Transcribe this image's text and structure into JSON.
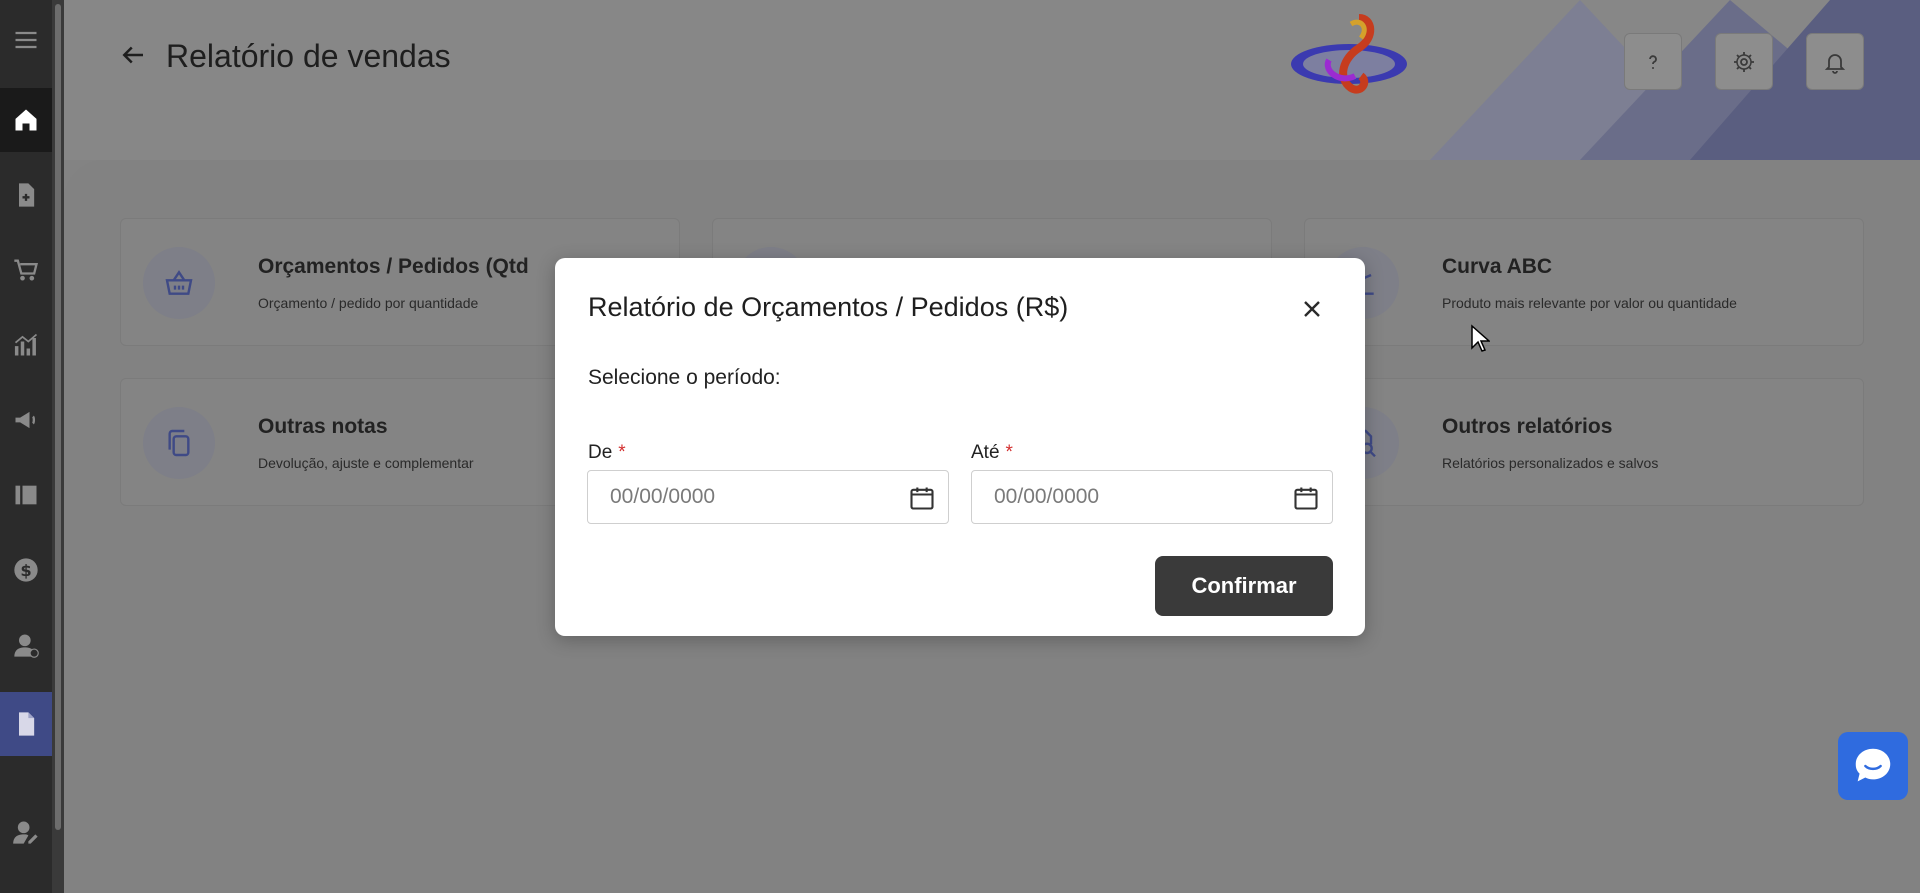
{
  "header": {
    "title": "Relatório de vendas"
  },
  "cards": [
    {
      "title": "Orçamentos / Pedidos (Qtd",
      "subtitle": "Orçamento / pedido por quantidade",
      "icon": "basket-icon"
    },
    {
      "title": "",
      "subtitle": "",
      "icon": "hidden-card-icon"
    },
    {
      "title": "Curva ABC",
      "subtitle": "Produto mais relevante por valor ou quantidade",
      "icon": "curve-abc-icon"
    },
    {
      "title": "Outras notas",
      "subtitle": "Devolução, ajuste e complementar",
      "icon": "copy-icon"
    },
    {
      "title": "Outros relatórios",
      "subtitle": "Relatórios personalizados e salvos",
      "icon": "report-search-icon"
    }
  ],
  "modal": {
    "title": "Relatório de Orçamentos / Pedidos (R$)",
    "subtitle": "Selecione o período:",
    "from_label": "De",
    "to_label": "Até",
    "required_mark": "*",
    "from_placeholder": "00/00/0000",
    "to_placeholder": "00/00/0000",
    "confirm_label": "Confirmar"
  },
  "colors": {
    "sidebar_active": "#3f4a86",
    "confirm_button": "#3a3a3a",
    "required": "#d32f2f",
    "chat_button": "#2f6bdf"
  },
  "icons": {
    "sidebar": [
      "menu-icon",
      "home-icon",
      "document-add-icon",
      "cart-icon",
      "chart-icon",
      "megaphone-icon",
      "books-icon",
      "dollar-icon",
      "user-money-icon",
      "report-icon",
      "user-settings-icon"
    ],
    "header": [
      "help-icon",
      "gear-icon",
      "bell-icon"
    ]
  }
}
